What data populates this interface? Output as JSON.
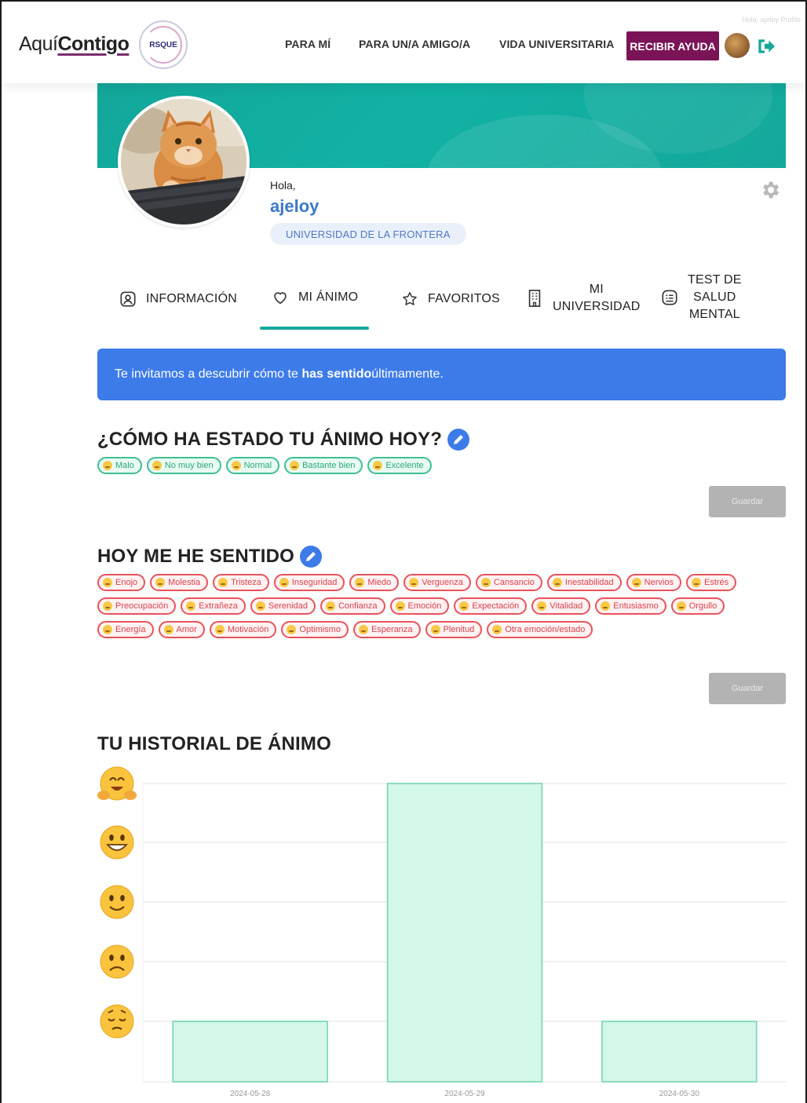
{
  "nav": {
    "brand_light": "Aquí",
    "brand_bold": "Contigo",
    "partner_logo": "RSQUE",
    "links": [
      "PARA MÍ",
      "PARA UN/A AMIGO/A",
      "VIDA UNIVERSITARIA"
    ],
    "help_button": "RECIBIR AYUDA",
    "corner_text": "Hola, ajeloy Profile"
  },
  "profile": {
    "greeting": "Hola,",
    "username": "ajeloy",
    "university": "UNIVERSIDAD DE LA FRONTERA"
  },
  "tabs": [
    {
      "label": "INFORMACIÓN",
      "icon": "user-icon"
    },
    {
      "label": "MI ÁNIMO",
      "icon": "heart-icon",
      "active": true
    },
    {
      "label": "FAVORITOS",
      "icon": "star-icon"
    },
    {
      "label_lines": [
        "MI",
        "UNIVERSIDAD"
      ],
      "icon": "building-icon"
    },
    {
      "label_lines": [
        "TEST DE",
        "SALUD",
        "MENTAL"
      ],
      "icon": "checklist-icon"
    }
  ],
  "info": {
    "before": "Te invitamos a descubrir cómo te ",
    "bold": "has sentido",
    "after": " últimamente."
  },
  "mood_today": {
    "title": "¿CÓMO HA ESTADO TU ÁNIMO HOY?",
    "options": [
      "Malo",
      "No muy bien",
      "Normal",
      "Bastante bien",
      "Excelente"
    ],
    "save_label": "Guardar"
  },
  "felt_today": {
    "title": "HOY ME HE SENTIDO",
    "emotions": [
      "Enojo",
      "Molestia",
      "Tristeza",
      "Inseguridad",
      "Miedo",
      "Verguenza",
      "Cansancio",
      "Inestabilidad",
      "Nervios",
      "Estrés",
      "Preocupación",
      "Extrañeza",
      "Serenidad",
      "Confianza",
      "Emoción",
      "Expectación",
      "Vitalidad",
      "Entusiasmo",
      "Orgullo",
      "Energía",
      "Amor",
      "Motivación",
      "Optimismo",
      "Esperanza",
      "Plenitud",
      "Otra emoción/estado"
    ],
    "save_label": "Guardar"
  },
  "history": {
    "title": "TU HISTORIAL DE ÁNIMO"
  },
  "chart_data": {
    "type": "bar",
    "categories": [
      "2024-05-28",
      "2024-05-29",
      "2024-05-30"
    ],
    "values": [
      1,
      5,
      1
    ],
    "ylim": [
      0,
      5
    ],
    "y_levels": [
      "sad-face-icon",
      "frown-face-icon",
      "smile-face-icon",
      "grin-face-icon",
      "hug-face-icon"
    ],
    "bar_color": "#d3f7e8",
    "bar_border": "#6fd4aa",
    "grid": true
  },
  "colors": {
    "accent_teal": "#13a79a",
    "help_purple": "#7a1457",
    "info_blue": "#3d7be8",
    "username_blue": "#3b78c9"
  }
}
